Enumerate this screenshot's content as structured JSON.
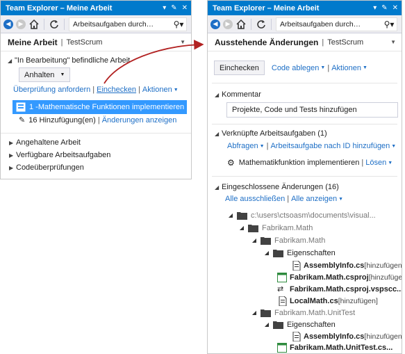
{
  "left": {
    "title": "Team Explorer – Meine Arbeit",
    "search_placeholder": "Arbeitsaufgaben durch…",
    "page_title": "Meine Arbeit",
    "project": "TestScrum",
    "in_progress_header": "\"In Bearbeitung\" befindliche Arbeit",
    "suspend_button": "Anhalten",
    "links": {
      "request_review": "Überprüfung anfordern",
      "checkin": "Einchecken",
      "actions": "Aktionen"
    },
    "work_item": "1 -Mathematische Funktionen implementieren",
    "changes_count": "16 Hinzufügung(en)",
    "show_changes": "Änderungen anzeigen",
    "sections": [
      "Angehaltene Arbeit",
      "Verfügbare Arbeitsaufgaben",
      "Codeüberprüfungen"
    ]
  },
  "right": {
    "title": "Team Explorer – Meine Arbeit",
    "search_placeholder": "Arbeitsaufgaben durch…",
    "page_title": "Ausstehende Änderungen",
    "project": "TestScrum",
    "checkin_button": "Einchecken",
    "shelve": "Code ablegen",
    "actions": "Aktionen",
    "comment_header": "Kommentar",
    "comment_value": "Projekte, Code und Tests hinzufügen",
    "linked_header": "Verknüpfte Arbeitsaufgaben (1)",
    "queries": "Abfragen",
    "add_by_id": "Arbeitsaufgabe nach ID hinzufügen",
    "linked_item": "Mathematikfunktion implementieren",
    "remove": "Lösen",
    "included_header": "Eingeschlossene Änderungen (16)",
    "exclude_all": "Alle ausschließen",
    "view_all": "Alle anzeigen",
    "tree": [
      {
        "label": "c:\\users\\ctsoasm\\documents\\visual...",
        "pending": ""
      },
      {
        "label": "Fabrikam.Math",
        "pending": ""
      },
      {
        "label": "Fabrikam.Math",
        "pending": ""
      },
      {
        "label": "Eigenschaften",
        "pending": ""
      },
      {
        "label": "AssemblyInfo.cs",
        "pending": "[hinzufügen]"
      },
      {
        "label": "Fabrikam.Math.csproj",
        "pending": "[hinzufügen]"
      },
      {
        "label": "Fabrikam.Math.csproj.vspscc...",
        "pending": ""
      },
      {
        "label": "LocalMath.cs",
        "pending": "[hinzufügen]"
      },
      {
        "label": "Fabrikam.Math.UnitTest",
        "pending": ""
      },
      {
        "label": "Eigenschaften",
        "pending": ""
      },
      {
        "label": "AssemblyInfo.cs",
        "pending": "[hinzufügen]"
      },
      {
        "label": "Fabrikam.Math.UnitTest.cs...",
        "pending": ""
      }
    ]
  },
  "colors": {
    "titlebar": "#007acc",
    "selection": "#3399ff",
    "link": "#1e6fc6",
    "arrow": "#b22222"
  }
}
